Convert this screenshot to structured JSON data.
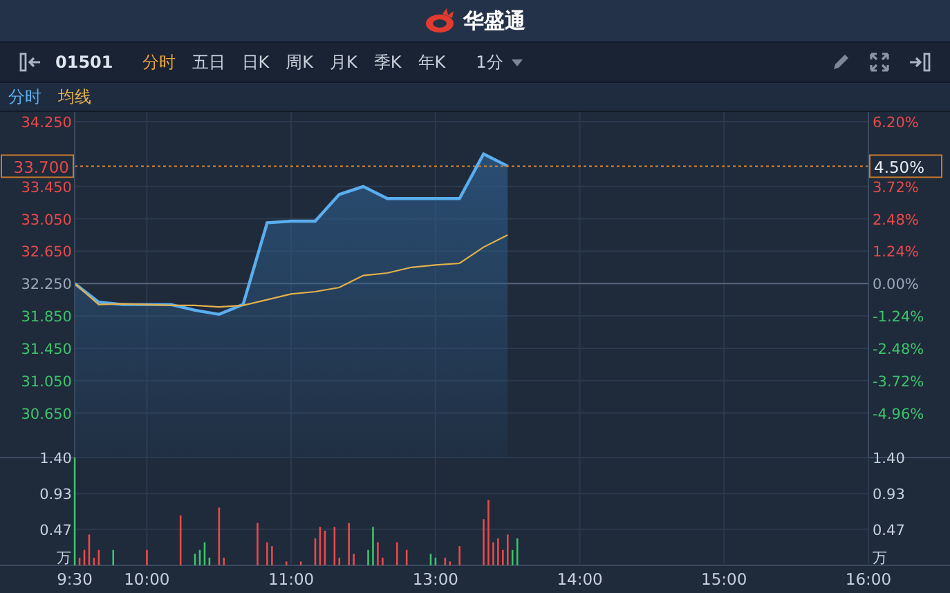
{
  "header": {
    "title": "华盛通"
  },
  "toolbar": {
    "code": "01501",
    "tabs": [
      {
        "label": "分时",
        "selected": true
      },
      {
        "label": "五日",
        "selected": false
      },
      {
        "label": "日K",
        "selected": false
      },
      {
        "label": "周K",
        "selected": false
      },
      {
        "label": "月K",
        "selected": false
      },
      {
        "label": "季K",
        "selected": false
      },
      {
        "label": "年K",
        "selected": false
      }
    ],
    "interval": "1分"
  },
  "price_chart": {
    "current_percent": "4.50%",
    "right_labels": [
      "6.20%",
      "3.72%",
      "2.48%",
      "1.24%",
      "0.00%",
      "-1.24%",
      "-2.48%",
      "-3.72%",
      "-4.96%"
    ],
    "chart_data": {
      "type": "line",
      "grid": true,
      "categories": [
        null,
        null,
        null,
        null,
        null,
        null,
        null,
        null,
        null,
        null,
        null,
        null,
        null,
        null,
        null,
        null,
        null,
        null,
        null,
        null,
        null,
        null,
        null,
        null,
        null,
        null,
        null,
        null,
        null,
        null,
        null,
        null,
        null,
        null
      ],
      "ylim": [
        30.1,
        34.37
      ],
      "yticks": [
        {
          "value": 30.65,
          "label": "30.650"
        },
        {
          "value": 31.05,
          "label": "31.050"
        },
        {
          "value": 31.45,
          "label": "31.450"
        },
        {
          "value": 31.85,
          "label": "31.850"
        },
        {
          "value": 32.25,
          "label": "32.250"
        },
        {
          "value": 32.65,
          "label": "32.650"
        },
        {
          "value": 33.05,
          "label": "33.050"
        },
        {
          "value": 33.45,
          "label": "33.450"
        },
        {
          "value": 34.25,
          "label": "34.250"
        }
      ],
      "series": [
        {
          "name": "分时",
          "color": "#5aaeef",
          "values": [
            32.25,
            32.02,
            31.99,
            31.99,
            31.99,
            31.92,
            31.87,
            31.99,
            33.0,
            33.02,
            33.02,
            33.35,
            33.45,
            33.3,
            33.3,
            33.3,
            33.3,
            33.85,
            33.7,
            null,
            null,
            null,
            null,
            null,
            null,
            null,
            null,
            null,
            null,
            null,
            null,
            null,
            null,
            null
          ]
        },
        {
          "name": "均线",
          "color": "#e3b04b",
          "values": [
            32.25,
            31.99,
            32.0,
            31.99,
            31.98,
            31.98,
            31.96,
            31.98,
            32.05,
            32.12,
            32.15,
            32.2,
            32.35,
            32.38,
            32.45,
            32.48,
            32.5,
            32.7,
            32.85,
            null,
            null,
            null,
            null,
            null,
            null,
            null,
            null,
            null,
            null,
            null,
            null,
            null,
            null,
            null
          ]
        }
      ],
      "ref_lines": [
        {
          "axis": "y",
          "value": 32.25
        },
        {
          "axis": "y",
          "value": 33.7
        }
      ],
      "annotations": [
        "33.700"
      ]
    }
  },
  "volume_chart": {
    "right_labels": [
      "1.40",
      "0.93",
      "0.47"
    ],
    "right_unit": "万",
    "chart_data": {
      "type": "bar",
      "grid": true,
      "ylabel": "万",
      "ylim": [
        0,
        1.4
      ],
      "categories": [
        "9:30",
        null,
        null,
        null,
        null,
        null,
        null,
        null,
        null,
        null,
        null,
        null,
        null,
        null,
        null,
        "10:00",
        null,
        null,
        null,
        null,
        null,
        null,
        null,
        null,
        null,
        null,
        null,
        null,
        null,
        null,
        null,
        null,
        null,
        null,
        null,
        null,
        null,
        null,
        null,
        null,
        null,
        null,
        null,
        null,
        null,
        "11:00",
        null,
        null,
        null,
        null,
        null,
        null,
        null,
        null,
        null,
        null,
        null,
        null,
        null,
        null,
        null,
        null,
        null,
        null,
        null,
        null,
        null,
        null,
        null,
        null,
        null,
        null,
        null,
        null,
        null,
        "13:00",
        null,
        null,
        null,
        null,
        null,
        null,
        null,
        null,
        null,
        null,
        null,
        null,
        null,
        null,
        null,
        null,
        null,
        null,
        null,
        null,
        null,
        null,
        null,
        null,
        null,
        null,
        null,
        null,
        null,
        "14:00",
        null,
        null,
        null,
        null,
        null,
        null,
        null,
        null,
        null,
        null,
        null,
        null,
        null,
        null,
        null,
        null,
        null,
        null,
        null,
        null,
        null,
        null,
        null,
        null,
        null,
        null,
        null,
        null,
        null,
        "15:00",
        null,
        null,
        null,
        null,
        null,
        null,
        null,
        null,
        null,
        null,
        null,
        null,
        null,
        null,
        null,
        null,
        null,
        null,
        null,
        null,
        null,
        null,
        null,
        null,
        null,
        null,
        null,
        null,
        null,
        "16:00"
      ],
      "yticks": [
        {
          "value": 0.47,
          "label": "0.47"
        },
        {
          "value": 0.93,
          "label": "0.93"
        },
        {
          "value": 1.4,
          "label": "1.40"
        }
      ],
      "series": [
        {
          "color": "#e84a4a",
          "values": [
            null,
            0.1,
            0.2,
            0.4,
            0.1,
            0.2,
            null,
            null,
            null,
            null,
            null,
            null,
            null,
            null,
            null,
            0.2,
            null,
            null,
            null,
            null,
            null,
            null,
            0.65,
            null,
            null,
            null,
            null,
            null,
            null,
            null,
            0.75,
            0.1,
            null,
            null,
            null,
            null,
            null,
            null,
            0.55,
            null,
            0.3,
            0.25,
            null,
            null,
            0.05,
            null,
            null,
            0.05,
            null,
            null,
            0.35,
            0.5,
            0.45,
            null,
            0.5,
            0.1,
            null,
            0.55,
            0.15,
            null,
            null,
            null,
            null,
            0.3,
            0.1,
            null,
            null,
            0.3,
            null,
            0.2,
            null,
            null,
            null,
            null,
            null,
            null,
            null,
            0.1,
            0.05,
            null,
            0.25,
            null,
            null,
            null,
            null,
            0.6,
            0.85,
            0.3,
            0.35,
            0.2,
            0.4,
            null,
            null,
            null,
            null,
            null,
            null,
            null,
            null,
            null,
            null,
            null,
            null,
            null,
            null,
            null,
            null,
            null,
            null,
            null,
            null,
            null,
            null,
            null,
            null,
            null,
            null,
            null,
            null,
            null,
            null,
            null,
            null,
            null,
            null,
            null,
            null,
            null,
            null,
            null,
            null,
            null,
            null,
            null,
            null,
            null,
            null,
            null,
            null,
            null,
            null,
            null,
            null,
            null,
            null,
            null,
            null,
            null,
            null,
            null,
            null,
            null,
            null,
            null,
            null,
            null,
            null,
            null,
            null,
            null,
            null,
            null,
            null,
            null,
            null,
            null
          ]
        },
        {
          "color": "#3cc36b",
          "values": [
            1.4,
            null,
            null,
            null,
            null,
            null,
            null,
            null,
            0.2,
            null,
            null,
            null,
            null,
            null,
            null,
            null,
            null,
            null,
            null,
            null,
            null,
            null,
            null,
            null,
            null,
            0.15,
            0.2,
            0.3,
            0.1,
            null,
            null,
            null,
            null,
            null,
            null,
            null,
            null,
            null,
            null,
            null,
            null,
            null,
            null,
            null,
            null,
            null,
            null,
            null,
            null,
            null,
            null,
            null,
            null,
            null,
            null,
            null,
            null,
            null,
            null,
            null,
            null,
            0.2,
            0.5,
            null,
            null,
            null,
            null,
            null,
            null,
            null,
            null,
            null,
            null,
            null,
            0.15,
            0.1,
            null,
            null,
            null,
            null,
            null,
            null,
            null,
            null,
            null,
            null,
            null,
            null,
            null,
            null,
            null,
            0.2,
            0.35,
            null,
            null,
            null,
            null,
            null,
            null,
            null,
            null,
            null,
            null,
            null,
            null,
            null,
            null,
            null,
            null,
            null,
            null,
            null,
            null,
            null,
            null,
            null,
            null,
            null,
            null,
            null,
            null,
            null,
            null,
            null,
            null,
            null,
            null,
            null,
            null,
            null,
            null,
            null,
            null,
            null,
            null,
            null,
            null,
            null,
            null,
            null,
            null,
            null,
            null,
            null,
            null,
            null,
            null,
            null,
            null,
            null,
            null,
            null,
            null,
            null,
            null,
            null,
            null,
            null,
            null,
            null,
            null,
            null,
            null,
            null,
            null,
            null
          ]
        }
      ]
    }
  }
}
